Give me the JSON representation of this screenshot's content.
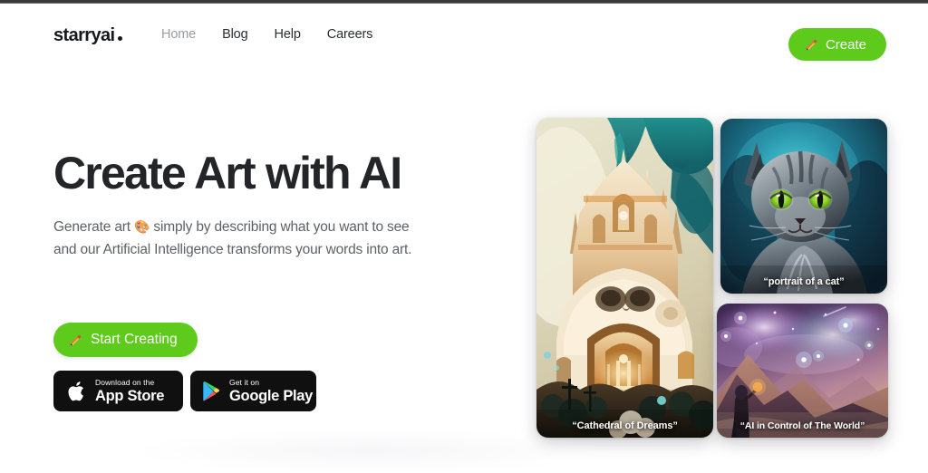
{
  "site": {
    "logo_text": "starryai",
    "logo_mark": "dot"
  },
  "header": {
    "nav": [
      {
        "label": "Home",
        "state": "muted"
      },
      {
        "label": "Blog",
        "state": "default"
      },
      {
        "label": "Help",
        "state": "default"
      },
      {
        "label": "Careers",
        "state": "default"
      }
    ],
    "create_button": {
      "label": "Create",
      "icon": "pencil-icon",
      "bg_color": "#5ecb1c",
      "text_color": "#ffffff"
    }
  },
  "hero": {
    "title": "Create Art with AI",
    "subtitle_line1_a": "Generate art ",
    "subtitle_emoji": "🎨",
    "subtitle_line1_b": " simply by describing what you want to see",
    "subtitle_line2": "and our Artificial Intelligence transforms your words into art.",
    "cta_button": {
      "label": "Start Creating",
      "icon": "paintbrush-icon",
      "bg_color": "#5ecb1c",
      "text_color": "#ffffff"
    },
    "store_badges": [
      {
        "icon": "apple-icon",
        "small_label": "Download on the",
        "big_label": "App Store",
        "bg_color": "#101010"
      },
      {
        "icon": "google-play-icon",
        "small_label": "Get it on",
        "big_label": "Google Play",
        "bg_color": "#101010"
      }
    ]
  },
  "gallery": {
    "cards": [
      {
        "name": "cathedral",
        "caption": "“Cathedral of Dreams”",
        "palette": [
          "#e8e3cf",
          "#d89a5a",
          "#f2e3c8",
          "#1d7d7e",
          "#3a2a1c"
        ]
      },
      {
        "name": "cat-portrait",
        "caption": "“portrait of a cat”",
        "palette": [
          "#12384a",
          "#3ec9d8",
          "#7f8a93",
          "#8ee03a",
          "#1a1f28"
        ]
      },
      {
        "name": "cosmos",
        "caption": "“AI in Control of The World”",
        "palette": [
          "#2b1f46",
          "#b48ad6",
          "#e9d6ef",
          "#8a5f74",
          "#c59a86"
        ]
      }
    ]
  },
  "theme": {
    "page_bg": "#ffffff",
    "accent": "#5ecb1c",
    "text_primary": "#232529",
    "text_secondary": "#5e6167",
    "nav_muted": "#9a9da3"
  }
}
